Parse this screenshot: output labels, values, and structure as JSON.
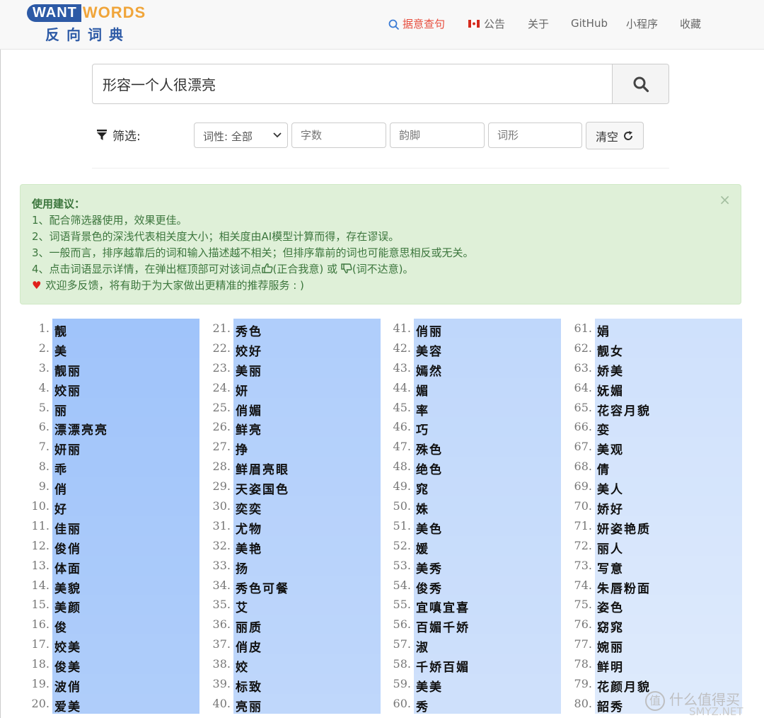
{
  "logo": {
    "want": "WANT",
    "words": "WORDS",
    "cn": "反向词典"
  },
  "nav": [
    {
      "label": "据意查句",
      "icon": "search-icon",
      "active": true
    },
    {
      "label": "公告",
      "icon": "flag-icon"
    },
    {
      "label": "关于"
    },
    {
      "label": "GitHub"
    },
    {
      "label": "小程序"
    },
    {
      "label": "收藏"
    }
  ],
  "search": {
    "value": "形容一个人很漂亮",
    "button_icon": "search-icon"
  },
  "filter": {
    "label": "筛选:",
    "pos": "词性: 全部",
    "char_count_placeholder": "字数",
    "rhyme_placeholder": "韵脚",
    "form_placeholder": "词形",
    "clear_label": "清空"
  },
  "tips": {
    "title": "使用建议：",
    "lines": [
      "1、配合筛选器使用，效果更佳。",
      "2、词语背景色的深浅代表相关度大小；相关度由AI模型计算而得，存在谬误。",
      "3、一般而言，排序越靠后的词和输入描述越不相关；但排序靠前的词也可能意思相反或无关。"
    ],
    "line4_a": "4、点击词语显示详情，在弹出框顶部可对该词点",
    "line4_b": "(正合我意) 或",
    "line4_c": "(词不达意)。",
    "feedback": "欢迎多反馈，将有助于为大家做出更精准的推荐服务 : )",
    "close": "×"
  },
  "results": {
    "columns": [
      {
        "start": 1,
        "words": [
          "靓",
          "美",
          "靓丽",
          "姣丽",
          "丽",
          "漂漂亮亮",
          "妍丽",
          "乖",
          "俏",
          "好",
          "佳丽",
          "俊俏",
          "体面",
          "美貌",
          "美颜",
          "俊",
          "姣美",
          "俊美",
          "波俏",
          "爱美"
        ]
      },
      {
        "start": 21,
        "words": [
          "秀色",
          "姣好",
          "美丽",
          "妍",
          "俏媚",
          "鲜亮",
          "挣",
          "鲜眉亮眼",
          "天姿国色",
          "奕奕",
          "尤物",
          "美艳",
          "扬",
          "秀色可餐",
          "艾",
          "丽质",
          "俏皮",
          "姣",
          "标致",
          "亮丽"
        ]
      },
      {
        "start": 41,
        "words": [
          "俏丽",
          "美容",
          "嫣然",
          "媚",
          "率",
          "巧",
          "殊色",
          "绝色",
          "窕",
          "姝",
          "美色",
          "媛",
          "美秀",
          "俊秀",
          "宜嗔宜喜",
          "百媚千娇",
          "淑",
          "千娇百媚",
          "美美",
          "秀"
        ]
      },
      {
        "start": 61,
        "words": [
          "娟",
          "靓女",
          "娇美",
          "妩媚",
          "花容月貌",
          "娈",
          "美观",
          "倩",
          "美人",
          "娇好",
          "妍姿艳质",
          "丽人",
          "写意",
          "朱唇粉面",
          "姿色",
          "窈窕",
          "婉丽",
          "鲜明",
          "花颜月貌",
          "韶秀"
        ]
      }
    ]
  },
  "watermark": {
    "text": "什么值得买",
    "sub": "SMYZ.NET"
  },
  "colors": {
    "accent_red": "#e74c3c",
    "logo_blue": "#2d5aa6",
    "logo_orange": "#f0a53a",
    "alert_green": "#3c763d"
  }
}
